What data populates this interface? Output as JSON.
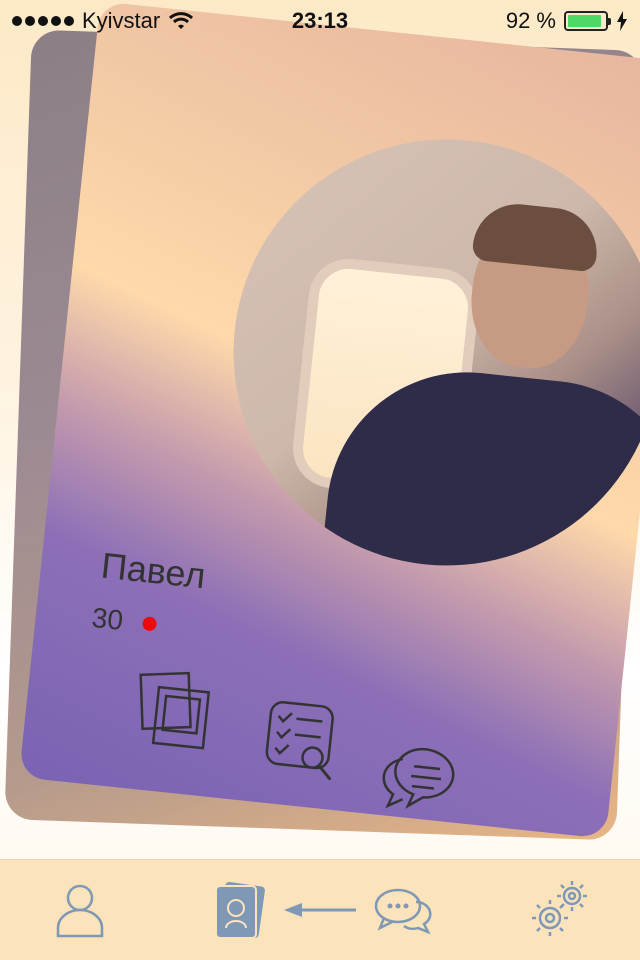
{
  "status_bar": {
    "carrier": "Kyivstar",
    "time": "23:13",
    "battery_percent_label": "92 %",
    "battery_level": 0.92
  },
  "profile_card": {
    "name": "Павел",
    "age": "30",
    "online": true
  },
  "card_actions": [
    {
      "icon": "photos-icon"
    },
    {
      "icon": "checklist-search-icon"
    },
    {
      "icon": "chat-bubbles-icon"
    }
  ],
  "tab_bar": {
    "items": [
      {
        "icon": "profile-icon"
      },
      {
        "icon": "cards-icon",
        "selected": true
      },
      {
        "icon": "messages-icon"
      },
      {
        "icon": "settings-gears-icon"
      }
    ]
  },
  "colors": {
    "accent": "#7f98b5",
    "online": "#ee0a0a",
    "tab_bar_bg": "#fbe3bb",
    "battery": "#4cd964"
  }
}
